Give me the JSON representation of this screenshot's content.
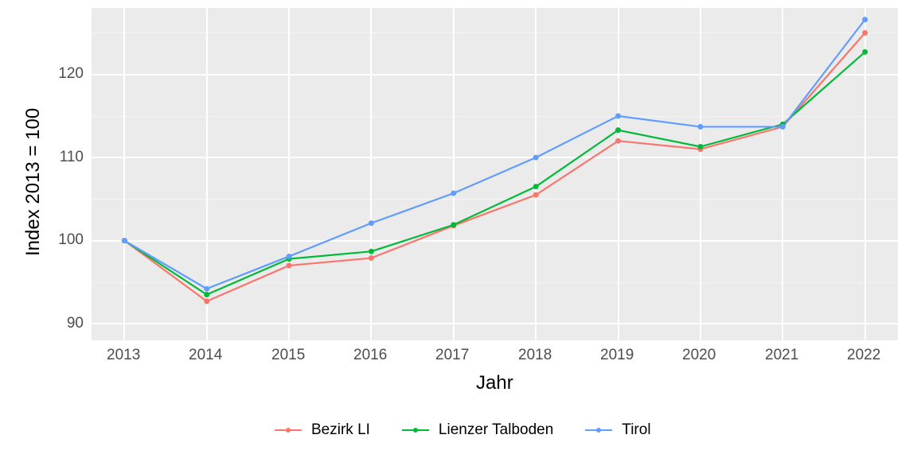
{
  "chart_data": {
    "type": "line",
    "x": [
      2013,
      2014,
      2015,
      2016,
      2017,
      2018,
      2019,
      2020,
      2021,
      2022
    ],
    "series": [
      {
        "name": "Bezirk LI",
        "color": "#f8766d",
        "values": [
          100.0,
          92.7,
          97.0,
          97.9,
          101.8,
          105.5,
          112.0,
          111.0,
          113.7,
          125.0
        ]
      },
      {
        "name": "Lienzer Talboden",
        "color": "#00ba38",
        "values": [
          100.0,
          93.5,
          97.8,
          98.7,
          101.9,
          106.5,
          113.3,
          111.3,
          114.0,
          122.7
        ]
      },
      {
        "name": "Tirol",
        "color": "#619cff",
        "values": [
          100.0,
          94.2,
          98.1,
          102.1,
          105.7,
          110.0,
          115.0,
          113.7,
          113.7,
          126.6
        ]
      }
    ],
    "xlabel": "Jahr",
    "ylabel": "Index  2013  = 100",
    "y_ticks": [
      90,
      100,
      110,
      120
    ],
    "ylim": [
      88,
      128
    ],
    "xlim": [
      2012.6,
      2022.4
    ],
    "grid": true
  },
  "axis": {
    "x2013": "2013",
    "x2014": "2014",
    "x2015": "2015",
    "x2016": "2016",
    "x2017": "2017",
    "x2018": "2018",
    "x2019": "2019",
    "x2020": "2020",
    "x2021": "2021",
    "x2022": "2022",
    "y90": "90",
    "y100": "100",
    "y110": "110",
    "y120": "120"
  },
  "legend": {
    "s0": "Bezirk LI",
    "s1": "Lienzer Talboden",
    "s2": "Tirol"
  },
  "labels": {
    "xlabel": "Jahr",
    "ylabel": "Index  2013  = 100"
  }
}
